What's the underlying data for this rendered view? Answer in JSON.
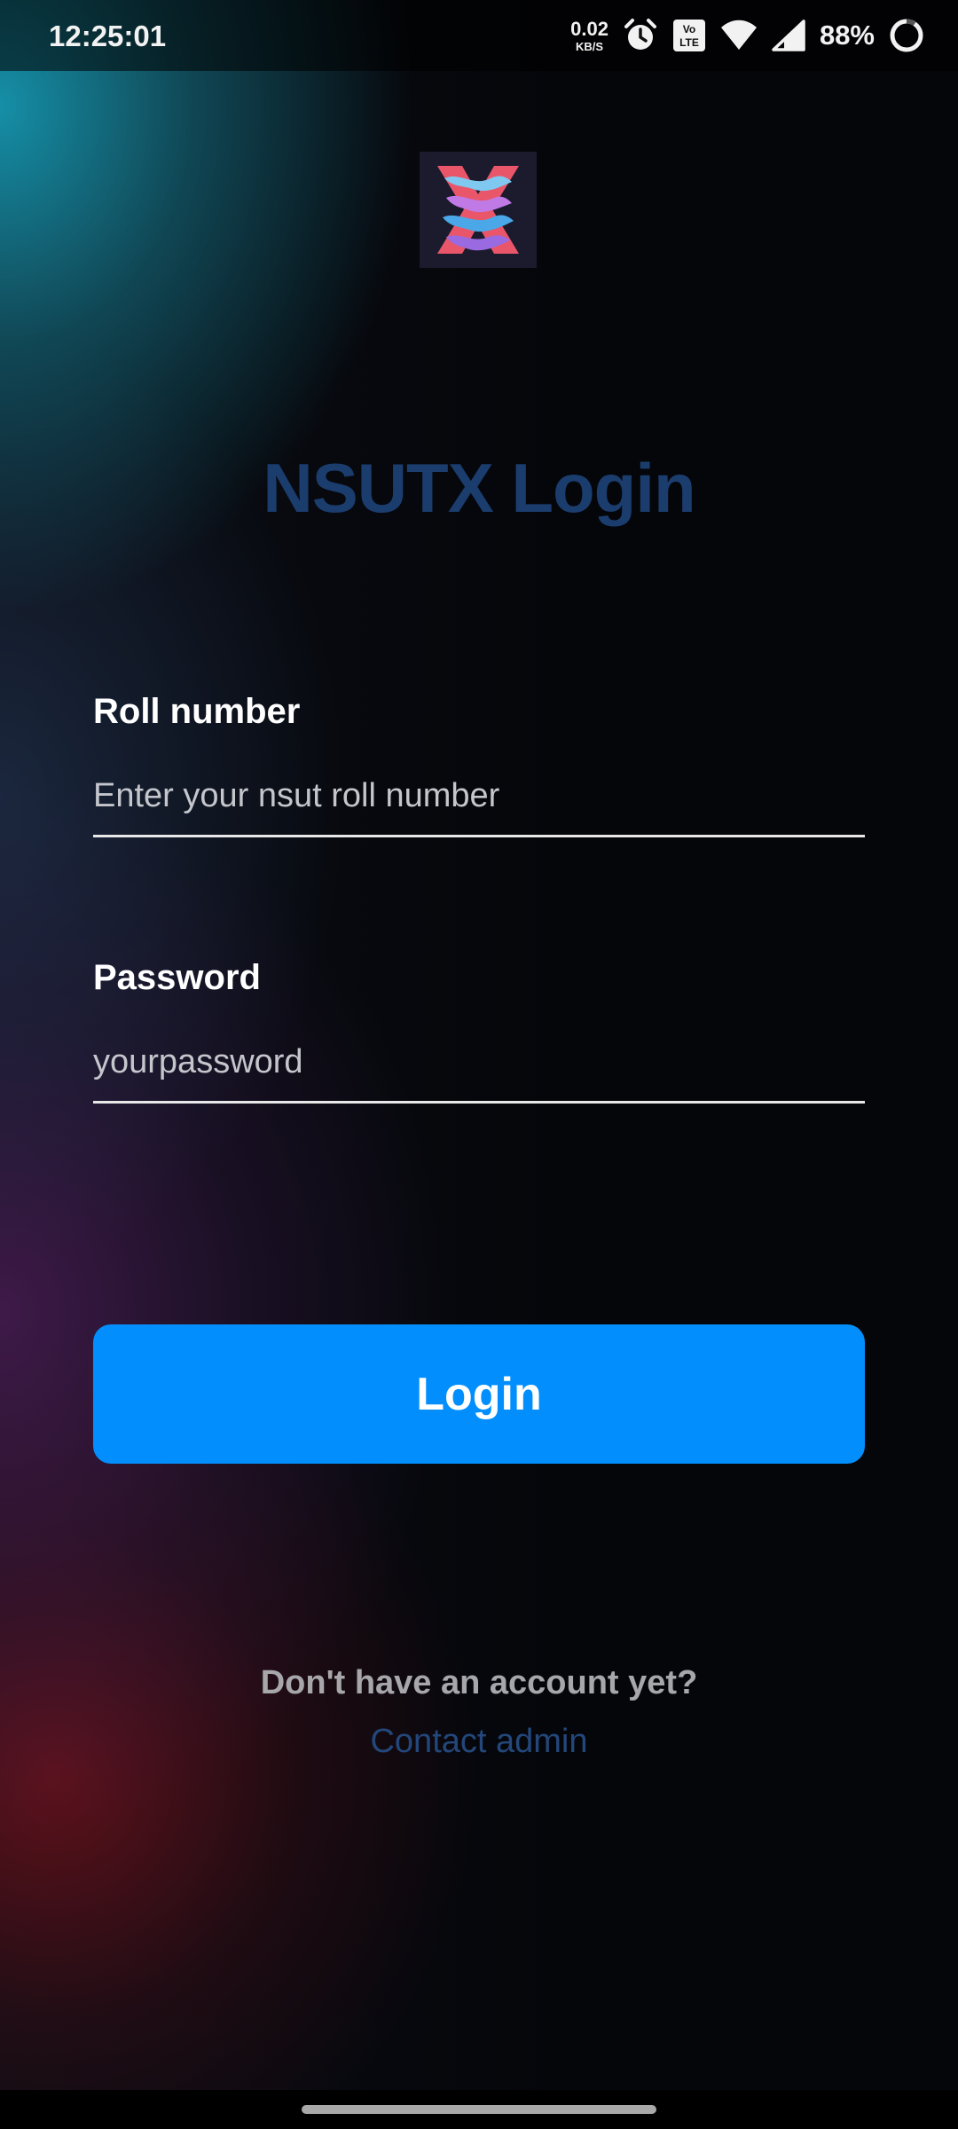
{
  "status_bar": {
    "time": "12:25:01",
    "net_speed": {
      "value": "0.02",
      "unit": "KB/S"
    },
    "icons": [
      "alarm-icon",
      "volte-icon",
      "wifi-icon",
      "cell-signal-icon",
      "battery-icon"
    ],
    "battery_percent": "88%"
  },
  "app": {
    "logo_icon": "nsutx-logo",
    "title": "NSUTX Login"
  },
  "form": {
    "roll_number": {
      "label": "Roll number",
      "placeholder": "Enter your nsut roll number",
      "value": ""
    },
    "password": {
      "label": "Password",
      "placeholder": "yourpassword",
      "value": ""
    },
    "login_label": "Login"
  },
  "footer": {
    "no_account_text": "Don't have an account yet?",
    "contact_link": "Contact admin"
  },
  "colors": {
    "title": "#1b3d6e",
    "button": "#028ffd",
    "link": "#23477a",
    "muted_text": "#a7a7ab"
  }
}
